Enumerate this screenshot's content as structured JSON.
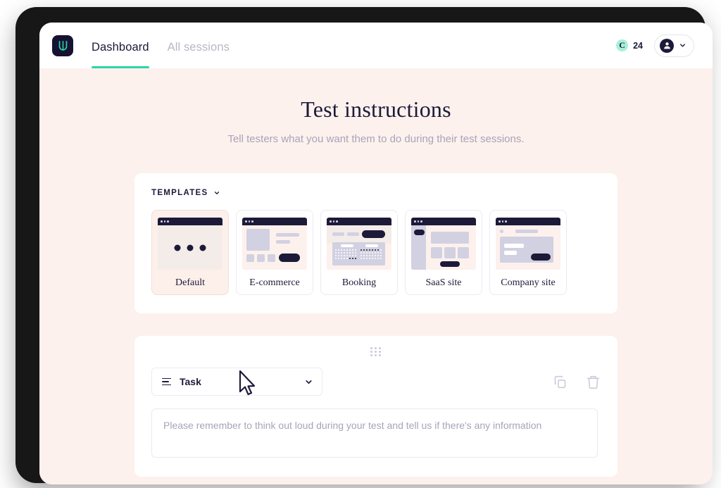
{
  "app": {
    "logo_icon": "uxtweak-u-logo-icon",
    "brand_color": "#2ad6a4"
  },
  "topbar": {
    "nav": [
      {
        "label": "Dashboard",
        "active": true
      },
      {
        "label": "All sessions",
        "active": false
      }
    ],
    "credits": {
      "icon": "credit-coin-icon",
      "symbol": "C",
      "count": "24"
    },
    "account": {
      "icon": "user-avatar-icon",
      "chevron": "chevron-down-icon"
    }
  },
  "page": {
    "title": "Test instructions",
    "subtitle": "Tell testers what you want them to do during their test sessions."
  },
  "templates": {
    "section_label": "TEMPLATES",
    "chevron": "chevron-down-icon",
    "items": [
      {
        "name": "Default",
        "selected": true
      },
      {
        "name": "E-commerce",
        "selected": false
      },
      {
        "name": "Booking",
        "selected": false
      },
      {
        "name": "SaaS site",
        "selected": false
      },
      {
        "name": "Company site",
        "selected": false
      }
    ]
  },
  "task": {
    "drag_handle_icon": "drag-handle-dots-icon",
    "type_icon": "task-lines-icon",
    "type_label": "Task",
    "type_chevron": "chevron-down-icon",
    "duplicate_icon": "copy-icon",
    "delete_icon": "trash-icon",
    "textarea_value": "",
    "textarea_placeholder": "Please remember to think out loud during your test and tell us if there's any information"
  },
  "cursor": {
    "icon": "arrow-pointer-cursor"
  },
  "colors": {
    "page_background": "#fdf1ed",
    "panel_background": "#ffffff",
    "ink": "#1c1a38",
    "muted": "#a7a4b8",
    "accent_teal": "#2ad6a4",
    "selected_card_bg": "#fdf0eb"
  }
}
